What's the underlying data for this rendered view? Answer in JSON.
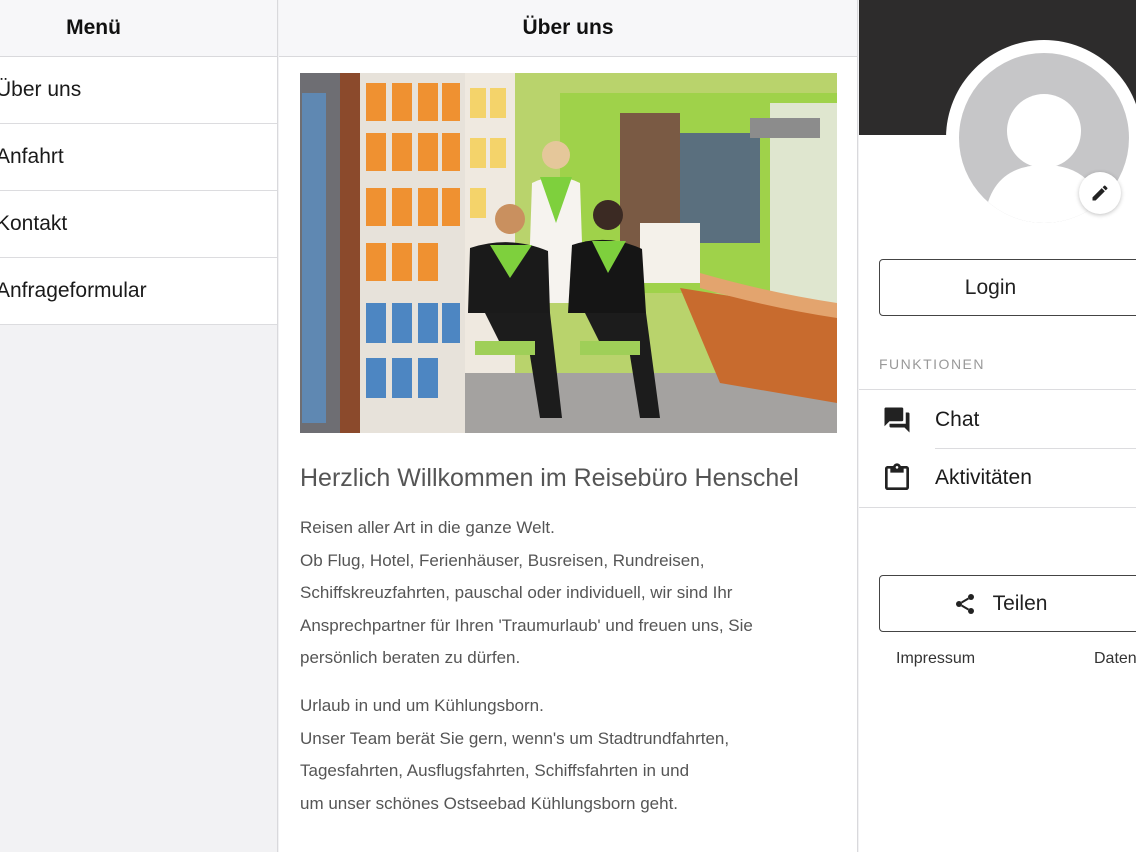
{
  "menu": {
    "title": "Menü",
    "items": [
      {
        "label": "Über uns"
      },
      {
        "label": "Anfahrt"
      },
      {
        "label": "Kontakt"
      },
      {
        "label": "Anfrageformular"
      }
    ]
  },
  "content": {
    "title": "Über uns",
    "headline": "Herzlich Willkommen im Reisebüro Henschel",
    "paragraph1": [
      "Reisen aller Art in die ganze Welt.",
      "Ob Flug, Hotel, Ferienhäuser, Busreisen, Rundreisen,",
      "Schiffskreuzfahrten, pauschal oder individuell, wir sind Ihr",
      "Ansprechpartner für Ihren 'Traumurlaub' und freuen uns, Sie",
      "persönlich beraten zu dürfen."
    ],
    "paragraph2": [
      "Urlaub in und um Kühlungsborn.",
      "Unser Team berät Sie gern, wenn's um Stadtrundfahrten,",
      "Tagesfahrten, Ausflugsfahrten, Schiffsfahrten in und",
      "um unser schönes Ostseebad Kühlungsborn geht."
    ]
  },
  "sidebar": {
    "login_label": "Login",
    "functions_title": "FUNKTIONEN",
    "functions": [
      {
        "label": "Chat",
        "icon": "chat-icon"
      },
      {
        "label": "Aktivitäten",
        "icon": "clipboard-icon"
      }
    ],
    "share_label": "Teilen",
    "footer_links": [
      "Impressum",
      "Daten"
    ]
  },
  "colors": {
    "dark_band": "#2d2c2c",
    "avatar_gray": "#c6c6c8",
    "text_gray": "#555555"
  }
}
